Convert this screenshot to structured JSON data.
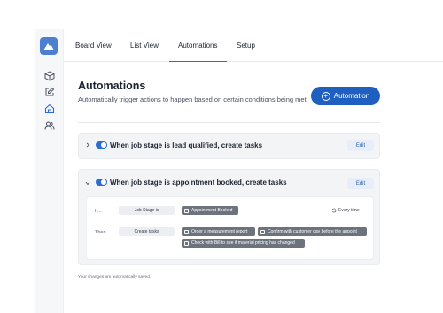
{
  "brand": {
    "logo_icon": "mountain-logo-icon",
    "accent": "#4c7fd0"
  },
  "sidebar": {
    "icons": [
      "cube-icon",
      "edit-icon",
      "home-icon",
      "users-icon"
    ],
    "active": "home-icon"
  },
  "tabs": [
    {
      "label": "Board View"
    },
    {
      "label": "List View"
    },
    {
      "label": "Automations"
    },
    {
      "label": "Setup"
    }
  ],
  "active_tab": "Automations",
  "header": {
    "title": "Automations",
    "subtitle": "Automatically trigger actions to happen based on certain conditions being met.",
    "button_label": "Automation",
    "button_color": "#1f5fbf"
  },
  "automations": [
    {
      "title": "When job stage is lead qualified, create tasks",
      "enabled": true,
      "expanded": false,
      "edit_label": "Edit"
    },
    {
      "title": "When job stage is appointment booked, create tasks",
      "enabled": true,
      "expanded": true,
      "edit_label": "Edit",
      "if_label": "If...",
      "condition": "Job Stage is",
      "condition_value": "Appointment Booked",
      "frequency": "Every time",
      "then_label": "Then...",
      "action": "Create tasks",
      "tasks": [
        "Order a measurement report",
        "Confirm with customer day before the appoint",
        "Check with Bill to see if material pricing has changed"
      ]
    }
  ],
  "footer": {
    "note": "Your changes are automatically saved."
  }
}
